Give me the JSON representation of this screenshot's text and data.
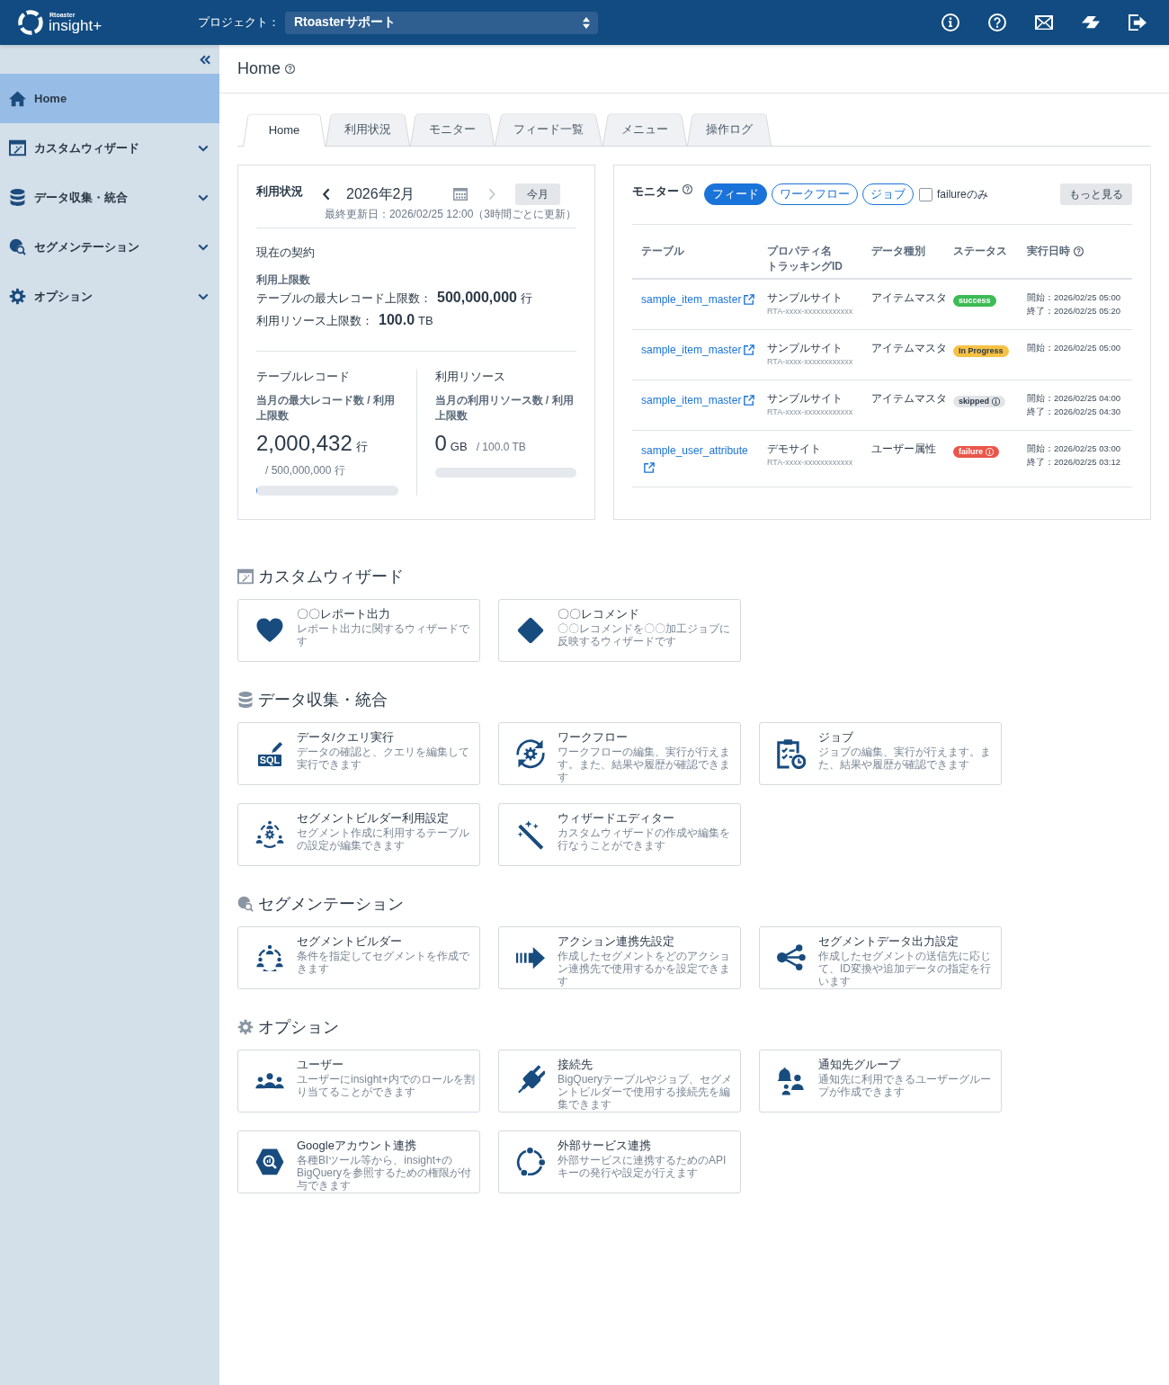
{
  "header": {
    "logo_small": "Rtoaster",
    "logo": "insight+",
    "project_label": "プロジェクト：",
    "project_value": "Rtoasterサポート"
  },
  "sidebar": {
    "items": [
      {
        "label": "Home",
        "kind": "link",
        "selected": true
      },
      {
        "label": "カスタムウィザード",
        "kind": "group",
        "selected": false
      },
      {
        "label": "データ収集・統合",
        "kind": "group",
        "selected": false
      },
      {
        "label": "セグメンテーション",
        "kind": "group",
        "selected": false
      },
      {
        "label": "オプション",
        "kind": "group",
        "selected": false
      }
    ]
  },
  "page": {
    "title": "Home"
  },
  "tabs": [
    {
      "label": "Home",
      "selected": true
    },
    {
      "label": "利用状況",
      "selected": false
    },
    {
      "label": "モニター",
      "selected": false
    },
    {
      "label": "フィード一覧",
      "selected": false
    },
    {
      "label": "メニュー",
      "selected": false
    },
    {
      "label": "操作ログ",
      "selected": false
    }
  ],
  "usage": {
    "title": "利用状況",
    "period": "2026年2月",
    "prev_button": {
      "disabled": false
    },
    "next_button": {
      "disabled": true
    },
    "today_button": "今月",
    "updated": "最終更新日：2026/02/25 12:00（3時間ごとに更新）",
    "contract": {
      "heading": "現在の契約",
      "subheading": "利用上限数",
      "limits": [
        {
          "label": "テーブルの最大レコード上限数：",
          "value": "500,000,000",
          "unit": "行"
        },
        {
          "label": "利用リソース上限数：",
          "value": "100.0",
          "unit": "TB"
        }
      ]
    },
    "metrics": [
      {
        "title": "テーブルレコード",
        "caption": "当月の最大レコード数 / 利用上限数",
        "value": "2,000,432",
        "unit": "行",
        "limit": "/ 500,000,000 行",
        "level": 0.004
      },
      {
        "title": "利用リソース",
        "caption": "当月の利用リソース数 / 利用上限数",
        "value": "0",
        "unit": "GB",
        "limit": "/ 100.0 TB",
        "level": 0
      }
    ]
  },
  "monitor": {
    "title": "モニター",
    "filters": [
      {
        "label": "フィード",
        "selected": true
      },
      {
        "label": "ワークフロー",
        "selected": false
      },
      {
        "label": "ジョブ",
        "selected": false
      }
    ],
    "failure_only": {
      "label": "failureのみ",
      "checked": false
    },
    "more_button": "もっと見る",
    "columns": [
      {
        "label": "テーブル",
        "help": false
      },
      {
        "label": "プロパティ名",
        "sublabel": "トラッキングID",
        "help": false
      },
      {
        "label": "データ種別",
        "help": false
      },
      {
        "label": "ステータス",
        "help": false
      },
      {
        "label": "実行日時",
        "help": true
      }
    ],
    "rows": [
      {
        "table": "sample_item_master",
        "property": "サンプルサイト",
        "tracking_id": "RTA-xxxx-xxxxxxxxxxxx",
        "data_type": "アイテムマスタ",
        "status": {
          "kind": "success",
          "label": "success"
        },
        "times": [
          "開始：2026/02/25 05:00",
          "終了：2026/02/25 05:20"
        ]
      },
      {
        "table": "sample_item_master",
        "property": "サンプルサイト",
        "tracking_id": "RTA-xxxx-xxxxxxxxxxxx",
        "data_type": "アイテムマスタ",
        "status": {
          "kind": "in_progress",
          "label": "In Progress"
        },
        "times": [
          "開始：2026/02/25 05:00"
        ]
      },
      {
        "table": "sample_item_master",
        "property": "サンプルサイト",
        "tracking_id": "RTA-xxxx-xxxxxxxxxxxx",
        "data_type": "アイテムマスタ",
        "status": {
          "kind": "skipped",
          "label": "skipped"
        },
        "times": [
          "開始：2026/02/25 04:00",
          "終了：2026/02/25 04:30"
        ]
      },
      {
        "table": "sample_user_attribute",
        "property": "デモサイト",
        "tracking_id": "RTA-xxxx-xxxxxxxxxxxx",
        "data_type": "ユーザー属性",
        "status": {
          "kind": "failure",
          "label": "failure"
        },
        "times": [
          "開始：2026/02/25 03:00",
          "終了：2026/02/25 03:12"
        ]
      }
    ]
  },
  "sections": [
    {
      "title": "カスタムウィザード",
      "cards": [
        {
          "title": "〇〇レポート出力",
          "description": "レポート出力に関するウィザードです"
        },
        {
          "title": "〇〇レコメンド",
          "description": "〇〇レコメンドを〇〇加工ジョブに反映するウィザードです"
        }
      ]
    },
    {
      "title": "データ収集・統合",
      "cards": [
        {
          "title": "データ/クエリ実行",
          "description": "データの確認と、クエリを編集して実行できます",
          "icon_label": "SQL"
        },
        {
          "title": "ワークフロー",
          "description": "ワークフローの編集、実行が行えます。また、結果や履歴が確認できます"
        },
        {
          "title": "ジョブ",
          "description": "ジョブの編集、実行が行えます。また、結果や履歴が確認できます"
        },
        {
          "title": "セグメントビルダー利用設定",
          "description": "セグメント作成に利用するテーブルの設定が編集できます"
        },
        {
          "title": "ウィザードエディター",
          "description": "カスタムウィザードの作成や編集を行なうことができます"
        }
      ]
    },
    {
      "title": "セグメンテーション",
      "cards": [
        {
          "title": "セグメントビルダー",
          "description": "条件を指定してセグメントを作成できます"
        },
        {
          "title": "アクション連携先設定",
          "description": "作成したセグメントをどのアクション連携先で使用するかを設定できます"
        },
        {
          "title": "セグメントデータ出力設定",
          "description": "作成したセグメントの送信先に応じて、ID変換や追加データの指定を行います"
        }
      ]
    },
    {
      "title": "オプション",
      "cards": [
        {
          "title": "ユーザー",
          "description": "ユーザーにinsight+内でのロールを割り当てることができます"
        },
        {
          "title": "接続先",
          "description": "BigQueryテーブルやジョブ、セグメントビルダーで使用する接続先を編集できます"
        },
        {
          "title": "通知先グループ",
          "description": "通知先に利用できるユーザーグループが作成できます"
        },
        {
          "title": "Googleアカウント連携",
          "description": "各種BIツール等から、insight+のBigQueryを参照するための権限が付与できます"
        },
        {
          "title": "外部サービス連携",
          "description": "外部サービスに連携するためのAPIキーの発行や設定が行えます"
        }
      ]
    }
  ]
}
